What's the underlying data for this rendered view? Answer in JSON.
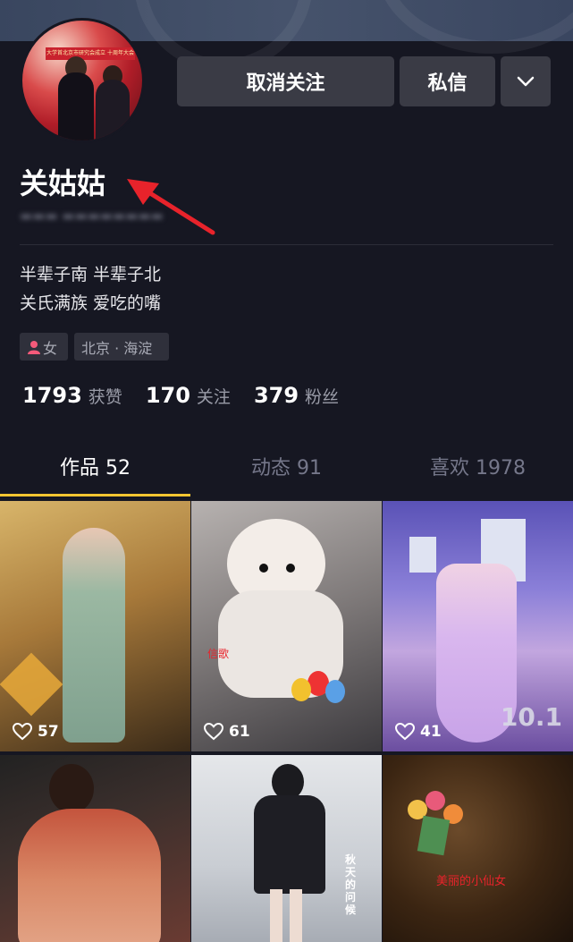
{
  "profile": {
    "name": "关姑姑",
    "bio_lines": [
      "半辈子南  半辈子北",
      "关氏满族   爱吃的嘴"
    ],
    "tags": {
      "gender": "女",
      "location": "北京 · 海淀"
    },
    "avatar_sign": "大学首北京市研究会成立 十周年大会"
  },
  "actions": {
    "unfollow": "取消关注",
    "message": "私信"
  },
  "stats": [
    {
      "value": "1793",
      "label": "获赞"
    },
    {
      "value": "170",
      "label": "关注"
    },
    {
      "value": "379",
      "label": "粉丝"
    }
  ],
  "tabs": [
    {
      "label": "作品 52"
    },
    {
      "label": "动态 91"
    },
    {
      "label": "喜欢 1978"
    }
  ],
  "videos": [
    {
      "likes": "57"
    },
    {
      "likes": "61",
      "overlay": "信歌"
    },
    {
      "likes": "41",
      "overlay": "10.1"
    },
    {
      "likes": ""
    },
    {
      "likes": "",
      "overlay": "秋天的问候"
    },
    {
      "likes": "",
      "overlay": "美丽的小仙女"
    }
  ],
  "colors": {
    "accent": "#f5c531",
    "background": "#161722",
    "button": "#3a3b45",
    "annotation_arrow": "#e8232b"
  }
}
